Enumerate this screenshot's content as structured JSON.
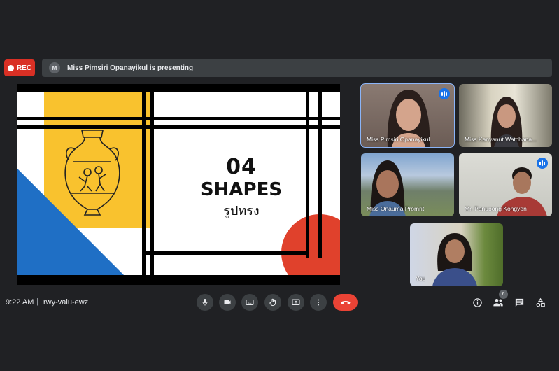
{
  "top_bar": {
    "rec_label": "REC",
    "presenter_initial": "M",
    "presenting_text": "Miss Pimsiri Opanayikul is presenting"
  },
  "slide": {
    "number": "04",
    "title": "SHAPES",
    "subtitle": "รูปทรง",
    "colors": {
      "yellow": "#f9c22e",
      "blue": "#1f6fc5",
      "red": "#e0412c"
    }
  },
  "participants": [
    {
      "name": "Miss Pimsiri Opanayikul",
      "speaking": true
    },
    {
      "name": "Miss Kanyanut Watchana...",
      "speaking": false
    },
    {
      "name": "Miss Onauma Promrit",
      "speaking": false
    },
    {
      "name": "Mr. Panupong Kongyen",
      "speaking": true
    },
    {
      "name": "You",
      "speaking": false
    }
  ],
  "bottom_bar": {
    "time": "9:22 AM",
    "separator": "|",
    "meeting_code": "rwy-vaiu-ewz",
    "people_count": "6"
  },
  "icons": [
    "mic-icon",
    "camera-icon",
    "captions-icon",
    "raise-hand-icon",
    "present-icon",
    "more-options-icon",
    "end-call-icon",
    "info-icon",
    "people-icon",
    "chat-icon",
    "activities-icon"
  ]
}
